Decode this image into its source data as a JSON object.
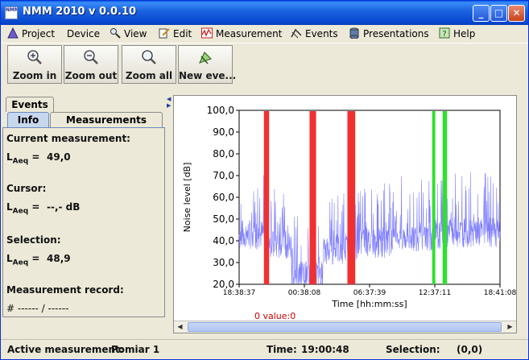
{
  "window": {
    "title": "NMM 2010 v 0.0.10",
    "app_icon_text": "NMM",
    "min": "_",
    "max": "□",
    "close": "✕"
  },
  "menu": [
    {
      "label": "Project",
      "icon": "project-icon"
    },
    {
      "label": "Device",
      "icon": ""
    },
    {
      "label": "View",
      "icon": "magnifier-icon"
    },
    {
      "label": "Edit",
      "icon": "edit-icon"
    },
    {
      "label": "Measurement",
      "icon": "measurement-icon"
    },
    {
      "label": "Events",
      "icon": "events-icon"
    },
    {
      "label": "Presentations",
      "icon": "presentations-icon"
    },
    {
      "label": "Help",
      "icon": "help-icon"
    }
  ],
  "toolbar": {
    "zoom_in": "Zoom in",
    "zoom_out": "Zoom out",
    "zoom_all": "Zoom all",
    "new_event": "New eve..."
  },
  "tabs": {
    "events": "Events",
    "info": "Info",
    "measurements": "Measurements"
  },
  "info": {
    "current_label": "Current measurement:",
    "laeq_main": "L",
    "laeq_sub": "Aeq",
    "equals": "=",
    "current_value": "49,0",
    "cursor_label": "Cursor:",
    "cursor_value": "--,- dB",
    "selection_label": "Selection:",
    "selection_value": "48,9",
    "record_label": "Measurement record:",
    "record_value": "# ------ / ------"
  },
  "scroll_label": "0 value:0",
  "status": {
    "active_label": "Active measurement:",
    "active_value": "Pomiar 1",
    "time_label": "Time:",
    "time_value": "19:00:48",
    "selection_label": "Selection:",
    "selection_value": "(0,0)"
  },
  "colors": {
    "series": "#8080ff",
    "event_red": "#f03030",
    "event_green": "#30e030",
    "scroll_label": "#cc0000"
  },
  "chart_data": {
    "type": "line",
    "ylabel": "Noise level [dB]",
    "xlabel": "Time [hh:mm:ss]",
    "ylim": [
      20,
      100
    ],
    "yticks": [
      "100,0",
      "90,0",
      "80,0",
      "70,0",
      "60,0",
      "50,0",
      "40,0",
      "30,0",
      "20,0"
    ],
    "xticks": [
      "18:38:37",
      "00:38:08",
      "06:37:39",
      "12:37:11",
      "18:41:08"
    ],
    "baseline_segments": [
      {
        "from": 0.0,
        "to": 0.1,
        "level": 43
      },
      {
        "from": 0.1,
        "to": 0.2,
        "level": 38
      },
      {
        "from": 0.2,
        "to": 0.32,
        "level": 24
      },
      {
        "from": 0.32,
        "to": 0.45,
        "level": 36
      },
      {
        "from": 0.45,
        "to": 0.6,
        "level": 39
      },
      {
        "from": 0.6,
        "to": 0.8,
        "level": 42
      },
      {
        "from": 0.8,
        "to": 1.0,
        "level": 44
      }
    ],
    "events": [
      {
        "type": "red",
        "start": 0.095,
        "end": 0.115
      },
      {
        "type": "red",
        "start": 0.27,
        "end": 0.295
      },
      {
        "type": "red",
        "start": 0.415,
        "end": 0.445
      },
      {
        "type": "green",
        "start": 0.74,
        "end": 0.752
      },
      {
        "type": "green",
        "start": 0.78,
        "end": 0.797
      }
    ]
  }
}
